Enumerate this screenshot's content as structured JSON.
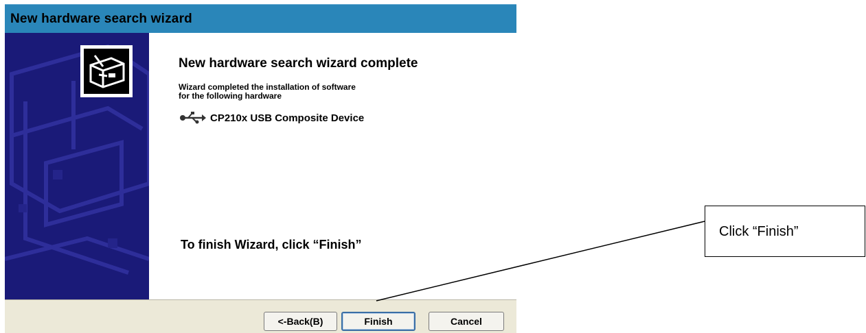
{
  "window": {
    "title": "New hardware search wizard"
  },
  "sidebar": {
    "icon": "hardware-box-icon"
  },
  "content": {
    "heading": "New hardware search wizard complete",
    "description_line1": "Wizard completed the installation of software",
    "description_line2": "for the following hardware",
    "device": {
      "icon": "usb-icon",
      "name": "CP210x USB Composite Device"
    },
    "finish_instruction": "To finish Wizard, click “Finish”"
  },
  "footer": {
    "back_label": "<-Back(B)",
    "finish_label": "Finish",
    "cancel_label": "Cancel"
  },
  "annotation": {
    "callout_text": "Click “Finish”"
  },
  "colors": {
    "titlebar": "#2a86b9",
    "sidebar": "#1a1a78",
    "footer": "#ece9d8"
  }
}
